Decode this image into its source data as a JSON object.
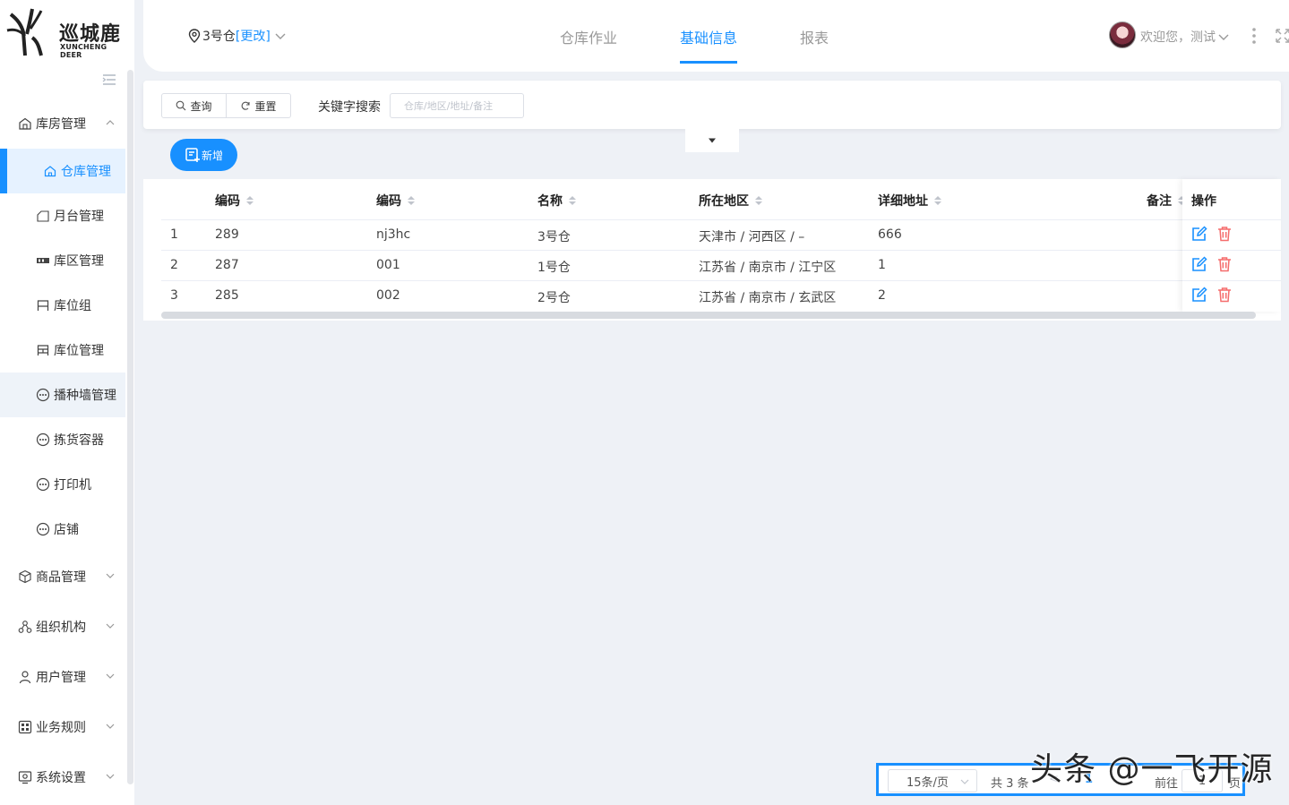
{
  "logo": {
    "brand": "巡城鹿",
    "brand_en": "XUNCHENG DEER"
  },
  "header": {
    "warehouse": "3号仓",
    "change_label": "[更改]",
    "tabs": [
      {
        "label": "仓库作业"
      },
      {
        "label": "基础信息"
      },
      {
        "label": "报表"
      }
    ],
    "active_tab": "基础信息",
    "welcome": "欢迎您，测试"
  },
  "sidebar": {
    "items": [
      {
        "label": "库房管理",
        "icon": "warehouse-icon",
        "level": "top",
        "expanded": true
      },
      {
        "label": "仓库管理",
        "icon": "home-icon",
        "level": "sub",
        "active": true
      },
      {
        "label": "月台管理",
        "icon": "platform-icon",
        "level": "sub"
      },
      {
        "label": "库区管理",
        "icon": "zone-icon",
        "level": "sub"
      },
      {
        "label": "库位组",
        "icon": "location-group-icon",
        "level": "sub"
      },
      {
        "label": "库位管理",
        "icon": "location-icon",
        "level": "sub"
      },
      {
        "label": "播种墙管理",
        "icon": "more-circle-icon",
        "level": "sub"
      },
      {
        "label": "拣货容器",
        "icon": "more-circle-icon",
        "level": "sub"
      },
      {
        "label": "打印机",
        "icon": "more-circle-icon",
        "level": "sub"
      },
      {
        "label": "店铺",
        "icon": "more-circle-icon",
        "level": "sub"
      },
      {
        "label": "商品管理",
        "icon": "box-icon",
        "level": "top"
      },
      {
        "label": "组织机构",
        "icon": "org-icon",
        "level": "top"
      },
      {
        "label": "用户管理",
        "icon": "user-icon",
        "level": "top"
      },
      {
        "label": "业务规则",
        "icon": "rules-icon",
        "level": "top"
      },
      {
        "label": "系统设置",
        "icon": "settings-icon",
        "level": "top"
      }
    ]
  },
  "search": {
    "query_label": "查询",
    "reset_label": "重置",
    "keyword_label": "关键字搜索",
    "keyword_placeholder": "仓库/地区/地址/备注",
    "keyword_value": ""
  },
  "toolbar": {
    "add_label": "新增"
  },
  "table": {
    "columns": [
      "编码",
      "编码",
      "名称",
      "所在地区",
      "详细地址",
      "备注",
      "操作"
    ],
    "rows": [
      {
        "index": "1",
        "code": "289",
        "code2": "nj3hc",
        "name": "3号仓",
        "region": "天津市 / 河西区 / –",
        "address": "666",
        "remark": ""
      },
      {
        "index": "2",
        "code": "287",
        "code2": "001",
        "name": "1号仓",
        "region": "江苏省 / 南京市 / 江宁区",
        "address": "1",
        "remark": ""
      },
      {
        "index": "3",
        "code": "285",
        "code2": "002",
        "name": "2号仓",
        "region": "江苏省 / 南京市 / 玄武区",
        "address": "2",
        "remark": ""
      }
    ]
  },
  "pagination": {
    "page_size": "15条/页",
    "total": "共 3 条",
    "prev": "<",
    "current_page": "1",
    "goto_label": "前往",
    "goto_value": "1",
    "page_unit": "页"
  },
  "watermark": "头条 @一飞开源",
  "colors": {
    "accent": "#1890ff",
    "danger": "#f56c6c",
    "background": "#eef1f6"
  }
}
